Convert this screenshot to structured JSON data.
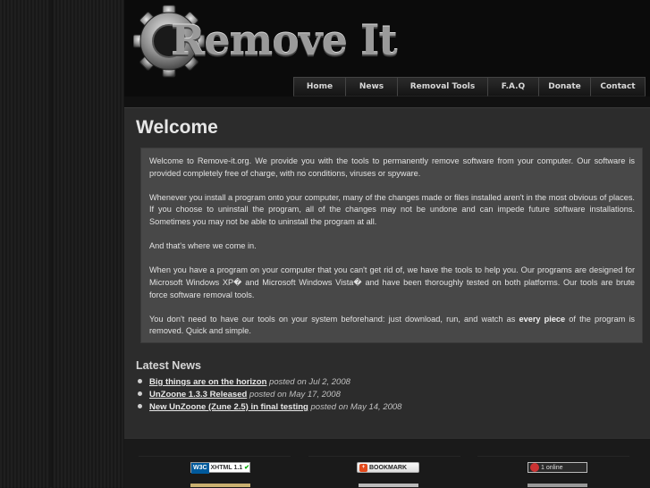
{
  "site": {
    "logo_text": "Remove It"
  },
  "nav": {
    "items": [
      "Home",
      "News",
      "Removal Tools",
      "F.A.Q",
      "Donate",
      "Contact"
    ]
  },
  "main": {
    "title": "Welcome",
    "paragraphs": {
      "p1": "Welcome to Remove-it.org. We provide you with the tools to permanently remove software from your computer. Our software is provided completely free of charge, with no conditions, viruses or spyware.",
      "p2": "Whenever you install a program onto your computer, many of the changes made or files installed aren't in the most obvious of places. If you choose to uninstall the program, all of the changes may not be undone and can impede future software installations. Sometimes you may not be able to uninstall the program at all.",
      "p3": "And that's where we come in.",
      "p4": "When you have a program on your computer that you can't get rid of, we have the tools to help you. Our programs are designed for Microsoft Windows XP� and Microsoft Windows Vista� and have been thoroughly tested on both platforms. Our tools are brute force software removal tools.",
      "p5_start": "You don't need to have our tools on your system beforehand: just download, run, and watch as ",
      "p5_bold": "every piece",
      "p5_end": " of the program is removed. Quick and simple."
    }
  },
  "news": {
    "heading": "Latest News",
    "items": [
      {
        "title": "Big things are on the horizon",
        "date": " posted on Jul 2, 2008"
      },
      {
        "title": "UnZoone 1.3.3 Released",
        "date": " posted on May 17, 2008"
      },
      {
        "title": "New UnZoone (Zune 2.5) in final testing",
        "date": " posted on May 14, 2008"
      }
    ]
  },
  "footer": {
    "w3c_label": "W3C",
    "xhtml_label": "XHTML 1.1",
    "bookmark_label": "BOOKMARK",
    "online_label": "1 online"
  }
}
